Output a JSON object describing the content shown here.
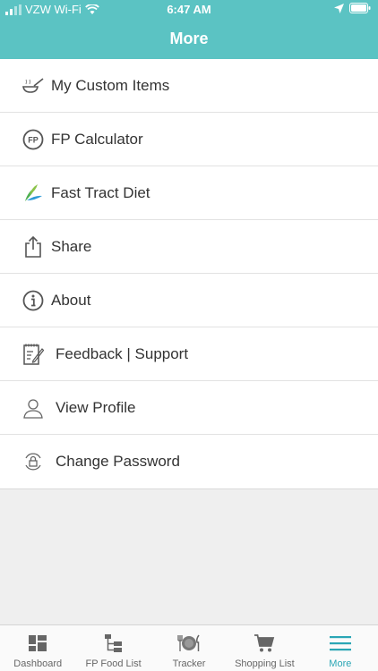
{
  "status": {
    "carrier": "VZW Wi-Fi",
    "time": "6:47 AM"
  },
  "header": {
    "title": "More"
  },
  "menu": {
    "items": [
      {
        "label": "My Custom Items",
        "icon": "bowl-spoon-icon"
      },
      {
        "label": "FP Calculator",
        "icon": "fp-calculator-icon"
      },
      {
        "label": "Fast Tract Diet",
        "icon": "fast-tract-leaf-icon"
      },
      {
        "label": "Share",
        "icon": "share-icon"
      },
      {
        "label": "About",
        "icon": "info-icon"
      },
      {
        "label": "Feedback | Support",
        "icon": "notepad-icon"
      },
      {
        "label": "View Profile",
        "icon": "user-icon"
      },
      {
        "label": "Change Password",
        "icon": "lock-refresh-icon"
      }
    ]
  },
  "tabs": [
    {
      "label": "Dashboard",
      "icon": "dashboard-icon"
    },
    {
      "label": "FP Food List",
      "icon": "hierarchy-icon"
    },
    {
      "label": "Tracker",
      "icon": "plate-cutlery-icon"
    },
    {
      "label": "Shopping List",
      "icon": "cart-icon"
    },
    {
      "label": "More",
      "icon": "hamburger-icon",
      "active": true
    }
  ],
  "colors": {
    "header": "#5bc3c3",
    "active_tab": "#2aa6b5",
    "background": "#efefef"
  }
}
